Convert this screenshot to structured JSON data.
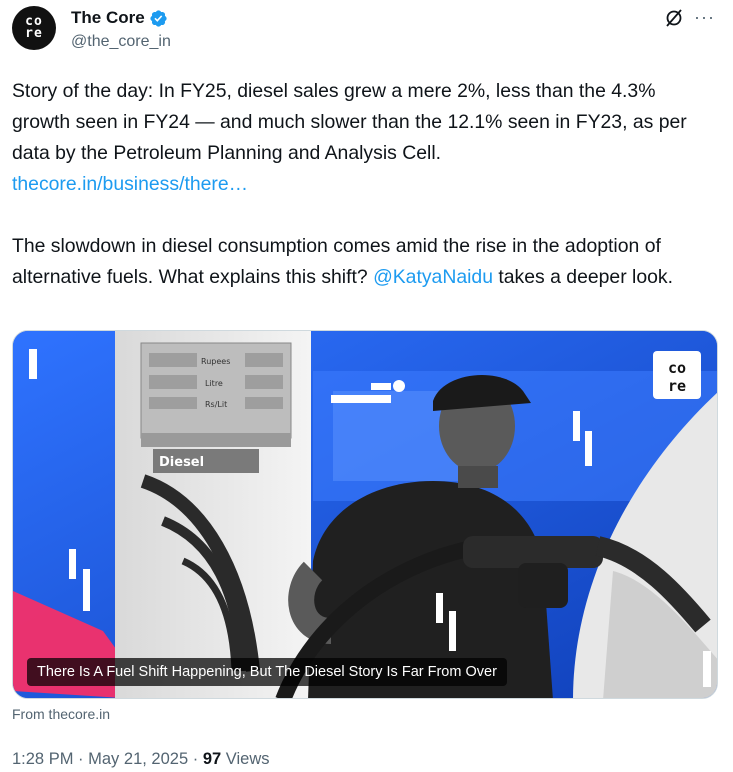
{
  "author": {
    "display_name": "The Core",
    "handle": "@the_core_in",
    "avatar_lines": [
      "co",
      "re"
    ]
  },
  "icons": {
    "verified": "verified-badge-icon",
    "grok": "grok-icon",
    "more": "more-icon"
  },
  "text": {
    "para1": "Story of the day: In FY25, diesel sales grew a mere 2%, less than the 4.3% growth seen in FY24 — and much slower than the 12.1% seen in FY23, as per data by the Petroleum Planning and Analysis Cell.",
    "link": "thecore.in/business/there…",
    "para2_before": "The slowdown in diesel consumption comes amid the rise in the adoption of alternative fuels. What explains this shift?",
    "mention": "@KatyaNaidu",
    "para2_after": "takes a deeper look."
  },
  "card": {
    "caption": "There Is A Fuel Shift Happening, But The Diesel Story Is Far From Over",
    "pump_label": "Diesel",
    "pump_rows": [
      "Rupees",
      "Litre",
      "Rs/Lit"
    ],
    "logo_lines": [
      "co",
      "re"
    ],
    "source": "From thecore.in"
  },
  "meta": {
    "time": "1:28 PM",
    "separator": "·",
    "date": "May 21, 2025",
    "views_count": "97",
    "views_label": "Views"
  },
  "colors": {
    "accent": "#1d9bf0",
    "text": "#0f1419",
    "muted": "#536471",
    "card_blue": "#1b57d9"
  }
}
